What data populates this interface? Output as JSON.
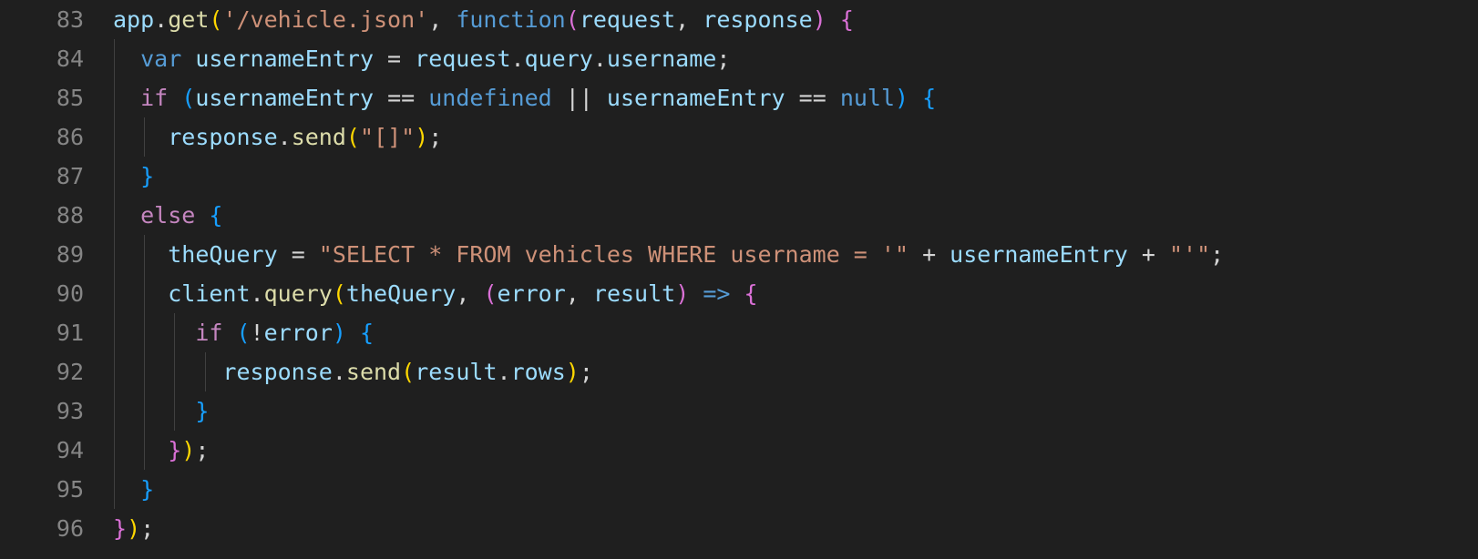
{
  "editor": {
    "language": "javascript",
    "colors": {
      "background": "#1f1f1f",
      "line_number": "#858585",
      "keyword": "#569cd6",
      "control": "#c586c0",
      "function": "#dcdcaa",
      "variable": "#9cdcfe",
      "string": "#ce9178",
      "punctuation": "#d4d4d4",
      "bracket_level_1": "#da70d6",
      "bracket_level_2": "#179fff",
      "bracket_level_3": "#ffd700"
    },
    "lines": [
      {
        "number": "83",
        "indent": 0,
        "tokens": [
          {
            "t": "app",
            "k": "var"
          },
          {
            "t": ".",
            "k": "punc"
          },
          {
            "t": "get",
            "k": "fn"
          },
          {
            "t": "(",
            "k": "br3"
          },
          {
            "t": "'/vehicle.json'",
            "k": "str"
          },
          {
            "t": ", ",
            "k": "punc"
          },
          {
            "t": "function",
            "k": "kw"
          },
          {
            "t": "(",
            "k": "br1"
          },
          {
            "t": "request",
            "k": "var"
          },
          {
            "t": ", ",
            "k": "punc"
          },
          {
            "t": "response",
            "k": "var"
          },
          {
            "t": ")",
            "k": "br1"
          },
          {
            "t": " ",
            "k": "punc"
          },
          {
            "t": "{",
            "k": "br1"
          }
        ]
      },
      {
        "number": "84",
        "indent": 1,
        "tokens": [
          {
            "t": "var",
            "k": "kw"
          },
          {
            "t": " ",
            "k": "punc"
          },
          {
            "t": "usernameEntry",
            "k": "var"
          },
          {
            "t": " = ",
            "k": "punc"
          },
          {
            "t": "request",
            "k": "var"
          },
          {
            "t": ".",
            "k": "punc"
          },
          {
            "t": "query",
            "k": "var"
          },
          {
            "t": ".",
            "k": "punc"
          },
          {
            "t": "username",
            "k": "var"
          },
          {
            "t": ";",
            "k": "punc"
          }
        ]
      },
      {
        "number": "85",
        "indent": 1,
        "tokens": [
          {
            "t": "if",
            "k": "ctrl"
          },
          {
            "t": " ",
            "k": "punc"
          },
          {
            "t": "(",
            "k": "br2"
          },
          {
            "t": "usernameEntry",
            "k": "var"
          },
          {
            "t": " == ",
            "k": "punc"
          },
          {
            "t": "undefined",
            "k": "kw"
          },
          {
            "t": " || ",
            "k": "punc"
          },
          {
            "t": "usernameEntry",
            "k": "var"
          },
          {
            "t": " == ",
            "k": "punc"
          },
          {
            "t": "null",
            "k": "kw"
          },
          {
            "t": ")",
            "k": "br2"
          },
          {
            "t": " ",
            "k": "punc"
          },
          {
            "t": "{",
            "k": "br2"
          }
        ]
      },
      {
        "number": "86",
        "indent": 2,
        "tokens": [
          {
            "t": "response",
            "k": "var"
          },
          {
            "t": ".",
            "k": "punc"
          },
          {
            "t": "send",
            "k": "fn"
          },
          {
            "t": "(",
            "k": "br3"
          },
          {
            "t": "\"[]\"",
            "k": "str"
          },
          {
            "t": ")",
            "k": "br3"
          },
          {
            "t": ";",
            "k": "punc"
          }
        ]
      },
      {
        "number": "87",
        "indent": 1,
        "tokens": [
          {
            "t": "}",
            "k": "br2"
          }
        ]
      },
      {
        "number": "88",
        "indent": 1,
        "tokens": [
          {
            "t": "else",
            "k": "ctrl"
          },
          {
            "t": " ",
            "k": "punc"
          },
          {
            "t": "{",
            "k": "br2"
          }
        ]
      },
      {
        "number": "89",
        "indent": 2,
        "tokens": [
          {
            "t": "theQuery",
            "k": "var"
          },
          {
            "t": " = ",
            "k": "punc"
          },
          {
            "t": "\"SELECT * FROM vehicles WHERE username = '\"",
            "k": "str"
          },
          {
            "t": " + ",
            "k": "punc"
          },
          {
            "t": "usernameEntry",
            "k": "var"
          },
          {
            "t": " + ",
            "k": "punc"
          },
          {
            "t": "\"'\"",
            "k": "str"
          },
          {
            "t": ";",
            "k": "punc"
          }
        ]
      },
      {
        "number": "90",
        "indent": 2,
        "tokens": [
          {
            "t": "client",
            "k": "var"
          },
          {
            "t": ".",
            "k": "punc"
          },
          {
            "t": "query",
            "k": "fn"
          },
          {
            "t": "(",
            "k": "br3"
          },
          {
            "t": "theQuery",
            "k": "var"
          },
          {
            "t": ", ",
            "k": "punc"
          },
          {
            "t": "(",
            "k": "br1"
          },
          {
            "t": "error",
            "k": "var"
          },
          {
            "t": ", ",
            "k": "punc"
          },
          {
            "t": "result",
            "k": "var"
          },
          {
            "t": ")",
            "k": "br1"
          },
          {
            "t": " ",
            "k": "punc"
          },
          {
            "t": "=>",
            "k": "kw"
          },
          {
            "t": " ",
            "k": "punc"
          },
          {
            "t": "{",
            "k": "br1"
          }
        ]
      },
      {
        "number": "91",
        "indent": 3,
        "tokens": [
          {
            "t": "if",
            "k": "ctrl"
          },
          {
            "t": " ",
            "k": "punc"
          },
          {
            "t": "(",
            "k": "br2"
          },
          {
            "t": "!",
            "k": "punc"
          },
          {
            "t": "error",
            "k": "var"
          },
          {
            "t": ")",
            "k": "br2"
          },
          {
            "t": " ",
            "k": "punc"
          },
          {
            "t": "{",
            "k": "br2"
          }
        ]
      },
      {
        "number": "92",
        "indent": 4,
        "tokens": [
          {
            "t": "response",
            "k": "var"
          },
          {
            "t": ".",
            "k": "punc"
          },
          {
            "t": "send",
            "k": "fn"
          },
          {
            "t": "(",
            "k": "br3"
          },
          {
            "t": "result",
            "k": "var"
          },
          {
            "t": ".",
            "k": "punc"
          },
          {
            "t": "rows",
            "k": "var"
          },
          {
            "t": ")",
            "k": "br3"
          },
          {
            "t": ";",
            "k": "punc"
          }
        ]
      },
      {
        "number": "93",
        "indent": 3,
        "tokens": [
          {
            "t": "}",
            "k": "br2"
          }
        ]
      },
      {
        "number": "94",
        "indent": 2,
        "tokens": [
          {
            "t": "}",
            "k": "br1"
          },
          {
            "t": ")",
            "k": "br3"
          },
          {
            "t": ";",
            "k": "punc"
          }
        ]
      },
      {
        "number": "95",
        "indent": 1,
        "tokens": [
          {
            "t": "}",
            "k": "br2"
          }
        ]
      },
      {
        "number": "96",
        "indent": 0,
        "tokens": [
          {
            "t": "}",
            "k": "br1"
          },
          {
            "t": ")",
            "k": "br3"
          },
          {
            "t": ";",
            "k": "punc"
          }
        ]
      }
    ]
  }
}
